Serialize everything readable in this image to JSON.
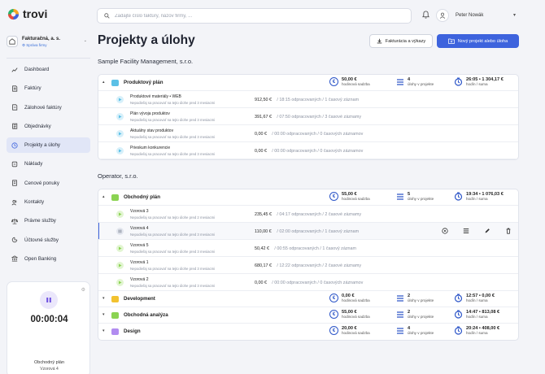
{
  "app": {
    "name": "trovi"
  },
  "search": {
    "placeholder": "Zadajte číslo faktúry, názov firmy, ..."
  },
  "user": {
    "name": "Peter Nowák"
  },
  "company": {
    "name": "Fakturačná, a. s.",
    "manage_label": "Správa firmy"
  },
  "sidebar": {
    "items": [
      {
        "label": "Dashboard",
        "icon": "chart-line-icon"
      },
      {
        "label": "Faktúry",
        "icon": "invoice-icon"
      },
      {
        "label": "Zálohové faktúry",
        "icon": "advance-invoice-icon"
      },
      {
        "label": "Objednávky",
        "icon": "order-icon"
      },
      {
        "label": "Projekty a úlohy",
        "icon": "clock-icon",
        "active": true
      },
      {
        "label": "Náklady",
        "icon": "costs-icon"
      },
      {
        "label": "Cenové ponuky",
        "icon": "quote-icon"
      },
      {
        "label": "Kontakty",
        "icon": "contacts-icon"
      },
      {
        "label": "Právne služby",
        "icon": "legal-icon"
      },
      {
        "label": "Účtovné služby",
        "icon": "accounting-icon"
      },
      {
        "label": "Open Banking",
        "icon": "bank-icon"
      }
    ]
  },
  "timer": {
    "time": "00:00:04",
    "project": "Obchodný plán",
    "task": "Vzorová 4"
  },
  "page": {
    "title": "Projekty a úlohy",
    "reports_button": "Fakturácia a výkazy",
    "new_button": "Nový projekt alebo úloha"
  },
  "labels": {
    "rate": "hodinová sadzba",
    "tasks": "úlohy v projekte",
    "hours": "hodín / suma"
  },
  "clients": [
    {
      "name": "Sample Facility Management, s.r.o.",
      "projects": [
        {
          "name": "Produktový plán",
          "color": "#5bc0e6",
          "rate": "50,00 €",
          "tasks": "4",
          "hours": "26:05 • 1 304,17 €",
          "expanded": true,
          "task_list": [
            {
              "name": "Produktové materiály • WEB",
              "note": "Nepodieľaj sa pracovať na tejto úlohe pred 3 mesiacmi",
              "amount": "912,50 €",
              "record": "/ 18:15 odpracovaných / 1 časový záznam"
            },
            {
              "name": "Plán vývoja produktov",
              "note": "Nepodieľaj sa pracovať na tejto úlohe pred 3 mesiacmi",
              "amount": "391,67 €",
              "record": "/ 07:50 odpracovaných / 3 časové záznamy"
            },
            {
              "name": "Aktuálny stav produktov",
              "note": "Nepodieľaj sa pracovať na tejto úlohe pred 3 mesiacmi",
              "amount": "0,00 €",
              "record": "/ 00:00 odpracovaných / 0 časových záznamov"
            },
            {
              "name": "Prieskum konkurencie",
              "note": "Nepodieľaj sa pracovať na tejto úlohe pred 3 mesiacmi",
              "amount": "0,00 €",
              "record": "/ 00:00 odpracovaných / 0 časových záznamov"
            }
          ]
        }
      ]
    },
    {
      "name": "Operator, s.r.o.",
      "projects": [
        {
          "name": "Obchodný plán",
          "color": "#8bd352",
          "rate": "55,00 €",
          "tasks": "5",
          "hours": "19:34 • 1 076,03 €",
          "expanded": true,
          "task_list": [
            {
              "name": "Vzorová 3",
              "note": "Nepodieľaj sa pracovať na tejto úlohe pred 2 mesiacmi",
              "amount": "235,45 €",
              "record": "/ 04:17 odpracovaných / 2 časové záznamy"
            },
            {
              "name": "Vzorová 4",
              "note": "Nepodieľaj sa pracovať na tejto úlohe pred 3 mesiacmi",
              "amount": "110,00 €",
              "record": "/ 02:00 odpracovaných / 1 časový záznam",
              "highlight": true
            },
            {
              "name": "Vzorová 5",
              "note": "Nepodieľaj sa pracovať na tejto úlohe pred 3 mesiacmi",
              "amount": "50,42 €",
              "record": "/ 00:55 odpracovaných / 1 časový záznam"
            },
            {
              "name": "Vzorová 1",
              "note": "Nepodieľaj sa pracovať na tejto úlohe pred 3 mesiacmi",
              "amount": "680,17 €",
              "record": "/ 12:22 odpracovaných / 2 časové záznamy"
            },
            {
              "name": "Vzorová 2",
              "note": "Nepodieľaj sa pracovať na tejto úlohe pred 3 mesiacmi",
              "amount": "0,00 €",
              "record": "/ 00:00 odpracovaných / 0 časových záznamov"
            }
          ]
        },
        {
          "name": "Development",
          "color": "#f2c230",
          "rate": "0,00 €",
          "tasks": "2",
          "hours": "12:57 • 0,00 €",
          "expanded": false
        },
        {
          "name": "Obchodná analýza",
          "color": "#8bd352",
          "rate": "55,00 €",
          "tasks": "2",
          "hours": "14:47 • 813,08 €",
          "expanded": false
        },
        {
          "name": "Design",
          "color": "#b18cf0",
          "rate": "20,00 €",
          "tasks": "4",
          "hours": "20:24 • 408,00 €",
          "expanded": false
        }
      ]
    }
  ]
}
